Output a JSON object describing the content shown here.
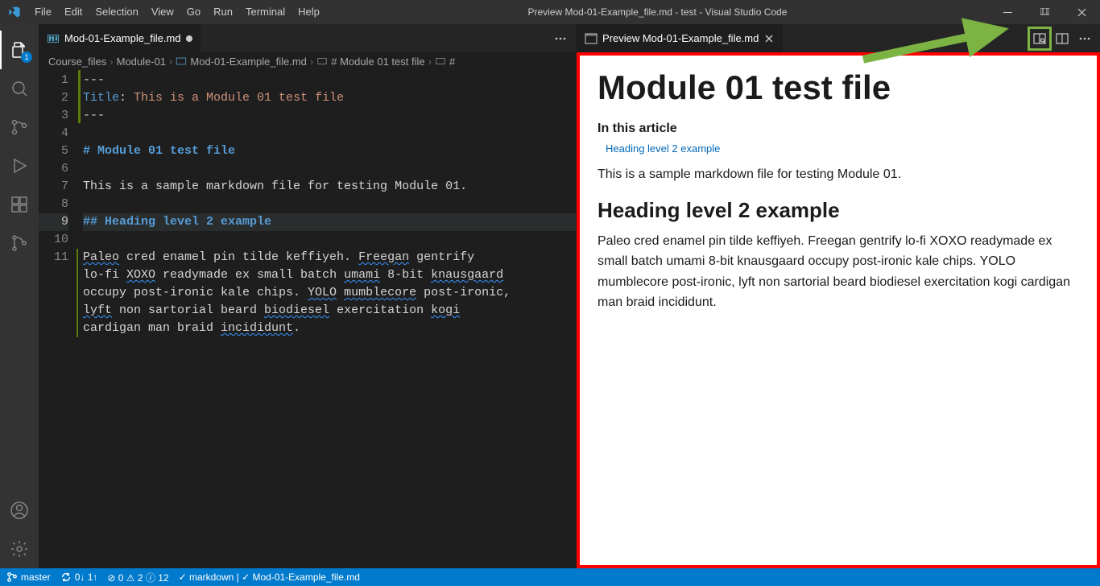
{
  "window": {
    "title": "Preview Mod-01-Example_file.md - test - Visual Studio Code"
  },
  "menu": [
    "File",
    "Edit",
    "Selection",
    "View",
    "Go",
    "Run",
    "Terminal",
    "Help"
  ],
  "activity": {
    "explorer_badge": "1"
  },
  "tabs": {
    "left": {
      "icon": "markdown",
      "label": "Mod-01-Example_file.md",
      "dirty": true
    },
    "right": {
      "icon": "preview",
      "label": "Preview Mod-01-Example_file.md"
    }
  },
  "breadcrumb": {
    "p1": "Course_files",
    "p2": "Module-01",
    "p3": "Mod-01-Example_file.md",
    "p4": "# Module 01 test file",
    "p5": "#"
  },
  "code": {
    "l1": "---",
    "l2_key": "Title",
    "l2_val": "This is a Module 01 test file",
    "l3": "---",
    "l5": "# Module 01 test file",
    "l7": "This is a sample markdown file for testing Module 01.",
    "l9": "## Heading level 2 example",
    "l11a": "Paleo",
    "l11b": " cred enamel pin tilde keffiyeh. ",
    "l11c": "Freegan",
    "l11d": " gentrify ",
    "l12a": "lo-fi ",
    "l12b": "XOXO",
    "l12c": " readymade ex small batch ",
    "l12d": "umami",
    "l12e": " 8-bit ",
    "l12f": "knausgaard",
    "l12g": " ",
    "l13a": "occupy post-ironic kale chips. ",
    "l13b": "YOLO",
    "l13c": " ",
    "l13d": "mumblecore",
    "l13e": " post-ironic, ",
    "l14a": "lyft",
    "l14b": " non sartorial beard ",
    "l14c": "biodiesel",
    "l14d": " exercitation ",
    "l14e": "kogi",
    "l14f": " ",
    "l15a": "cardigan man braid ",
    "l15b": "incididunt",
    "l15c": "."
  },
  "line_numbers": [
    "1",
    "2",
    "3",
    "4",
    "5",
    "6",
    "7",
    "8",
    "9",
    "10",
    "11"
  ],
  "preview": {
    "h1": "Module 01 test file",
    "toc_title": "In this article",
    "toc_link": "Heading level 2 example",
    "p1": "This is a sample markdown file for testing Module 01.",
    "h2": "Heading level 2 example",
    "p2": "Paleo cred enamel pin tilde keffiyeh. Freegan gentrify lo-fi XOXO readymade ex small batch umami 8-bit knausgaard occupy post-ironic kale chips. YOLO mumblecore post-ironic, lyft non sartorial beard biodiesel exercitation kogi cardigan man braid incididunt."
  },
  "status": {
    "branch": "master",
    "sync": "0↓ 1↑",
    "problems": "⊘ 0 ⚠ 2 ⓘ 12",
    "lint": "✓ markdown | ✓ Mod-01-Example_file.md"
  }
}
